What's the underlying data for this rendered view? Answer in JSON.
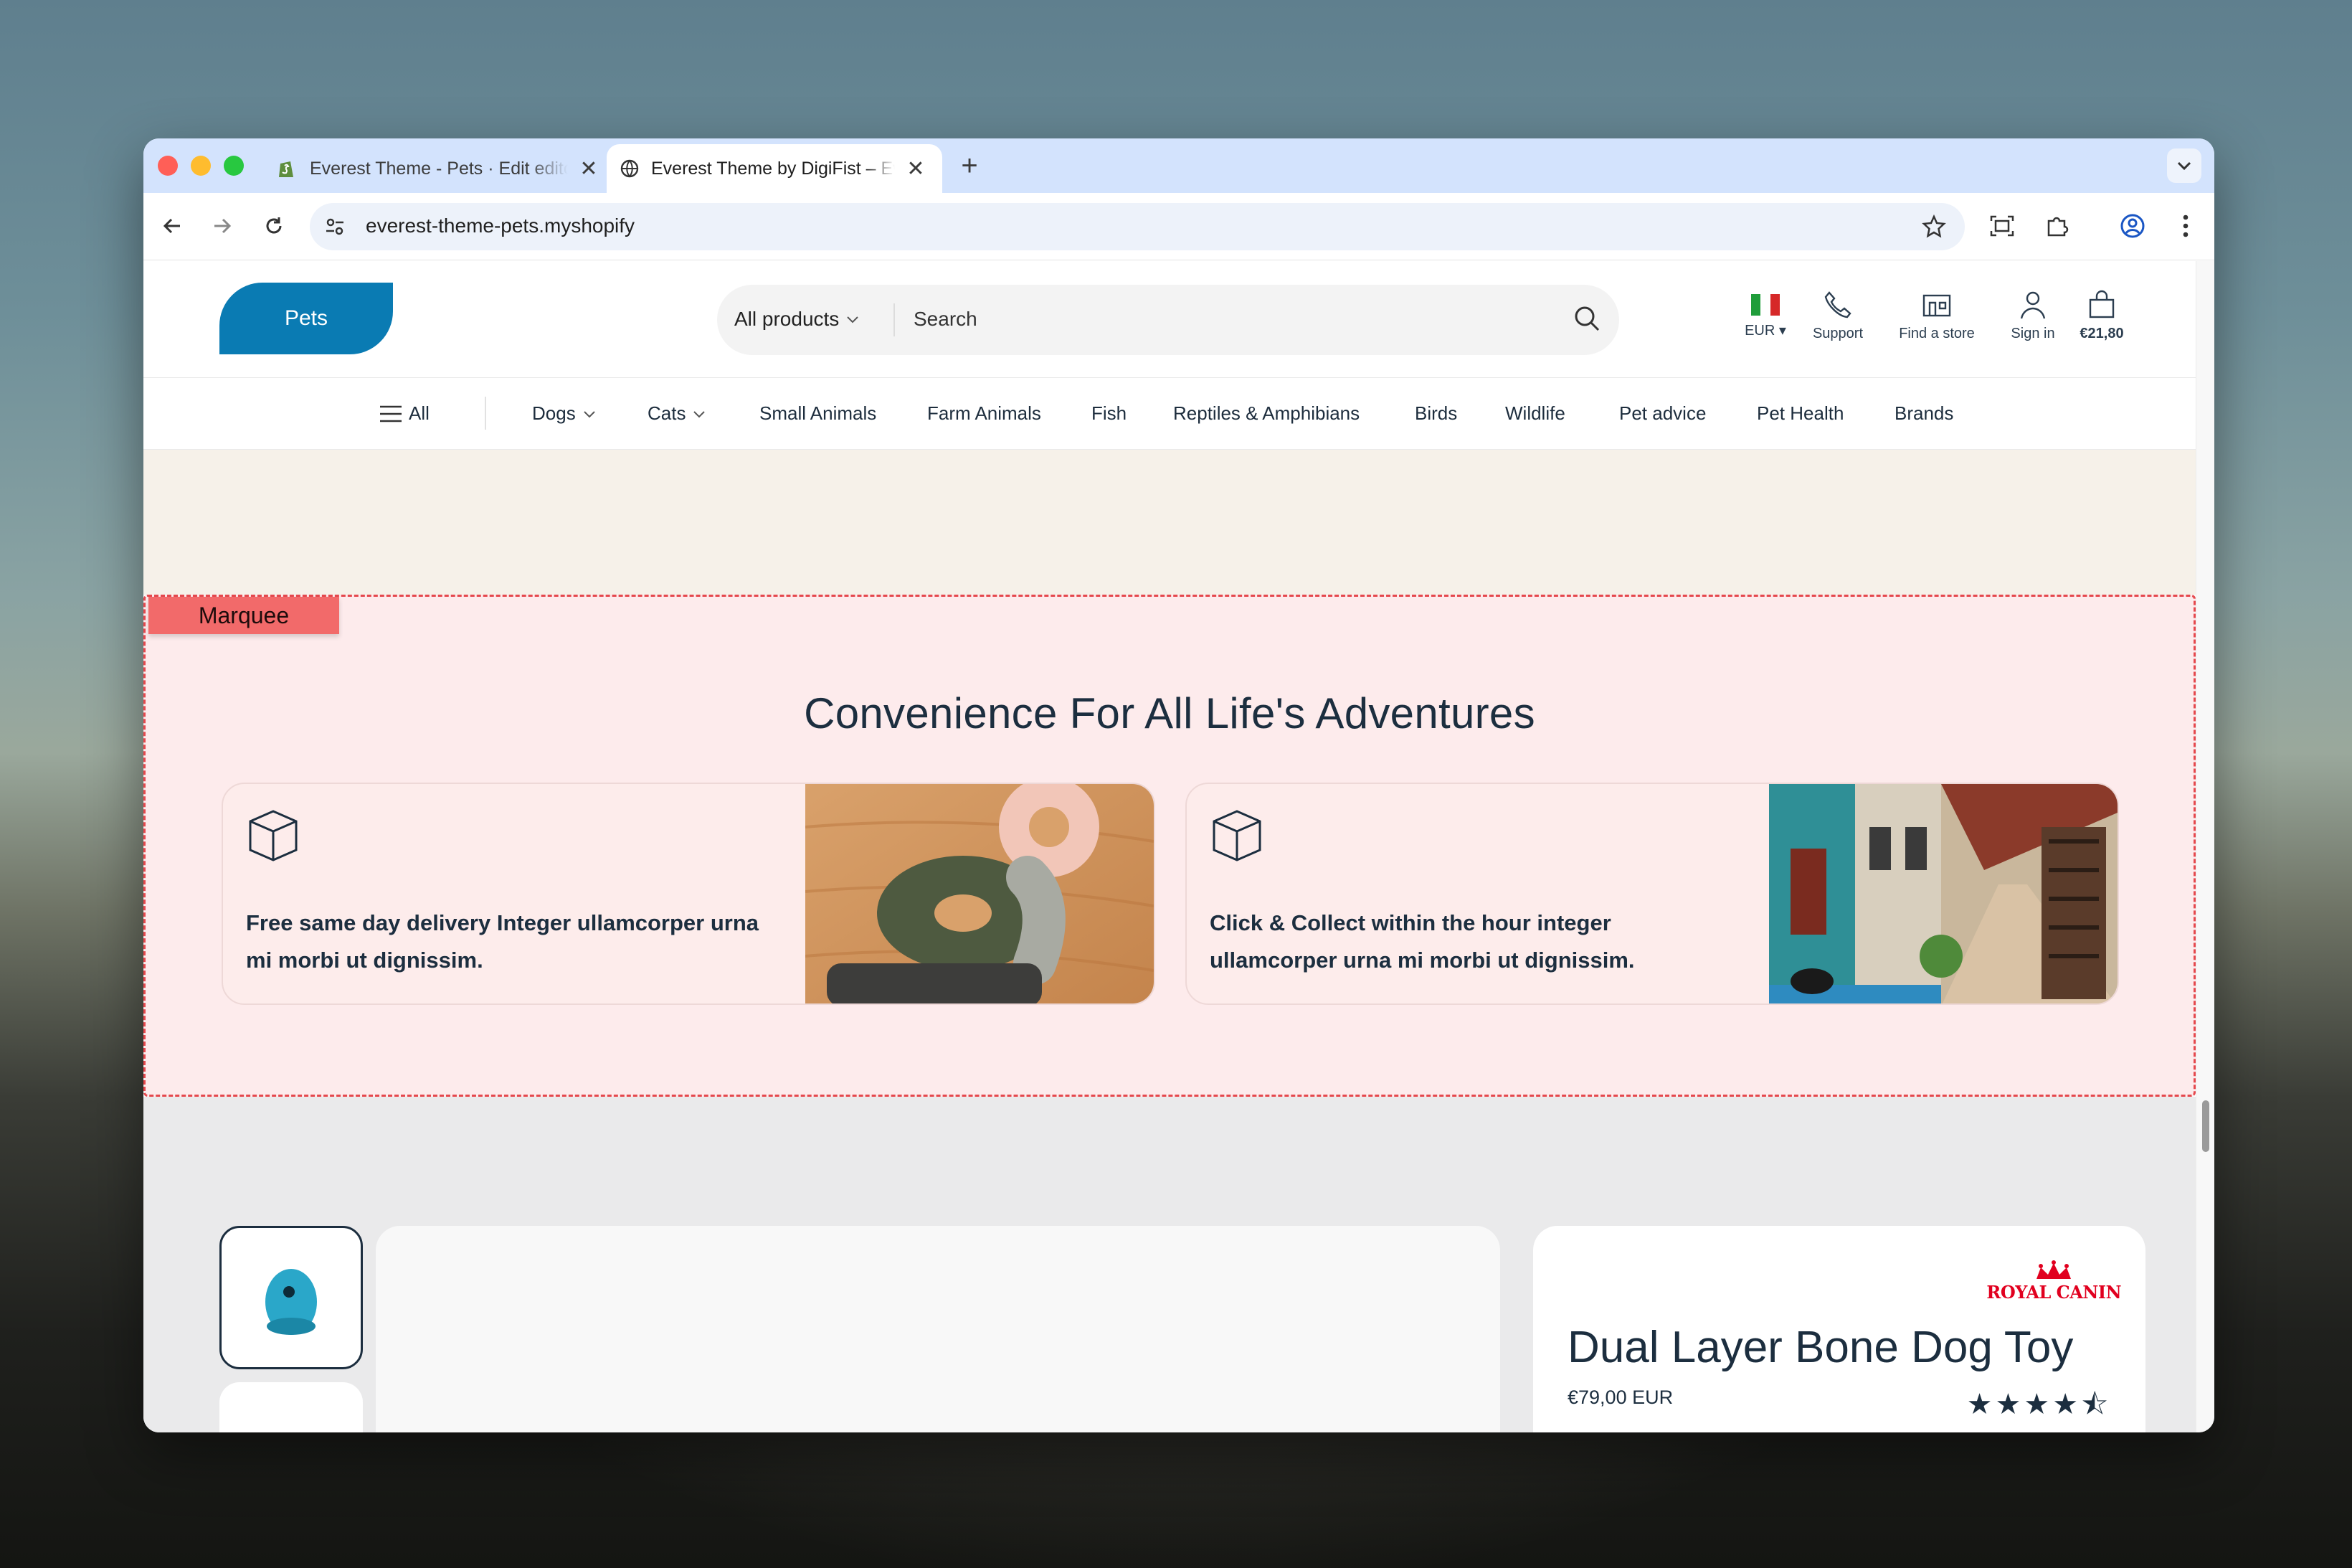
{
  "browser": {
    "tabs": [
      {
        "title": "Everest Theme - Pets · Edit editor",
        "close": "✕"
      },
      {
        "title": "Everest Theme by DigiFist – Everest",
        "close": "✕"
      }
    ],
    "new_tab": "+",
    "url": "everest-theme-pets.myshopify"
  },
  "header": {
    "logo": "Pets",
    "search": {
      "category": "All products",
      "placeholder": "Search"
    },
    "currency": "EUR ▾",
    "support": "Support",
    "find_store": "Find a store",
    "sign_in": "Sign in",
    "cart": "€21,80",
    "flag_colors": [
      "#1f9d3a",
      "#ffffff",
      "#d62828"
    ]
  },
  "nav": {
    "all": "All",
    "items": [
      "Dogs",
      "Cats",
      "Small Animals",
      "Farm Animals",
      "Fish",
      "Reptiles & Amphibians",
      "Birds",
      "Wildlife",
      "Pet advice",
      "Pet Health",
      "Brands"
    ]
  },
  "marquee": {
    "tag": "Marquee",
    "title": "Convenience For All Life's Adventures",
    "cards": [
      {
        "icon": "box-icon",
        "text": "Free same day delivery Integer ullamcorper urna mi morbi ut dignissim."
      },
      {
        "icon": "box-icon",
        "text": "Click & Collect within the hour integer ullamcorper urna mi morbi ut dignissim."
      }
    ]
  },
  "product": {
    "brand": "ROYAL CANIN",
    "name": "Dual Layer Bone Dog Toy",
    "price": "€79,00 EUR",
    "rating": 4.5,
    "stars": "★★★★⯪"
  },
  "colors": {
    "accent": "#0a7bb3",
    "text": "#1c2e3f",
    "marquee_bg": "#fdebec",
    "marquee_border": "#e5484d"
  }
}
